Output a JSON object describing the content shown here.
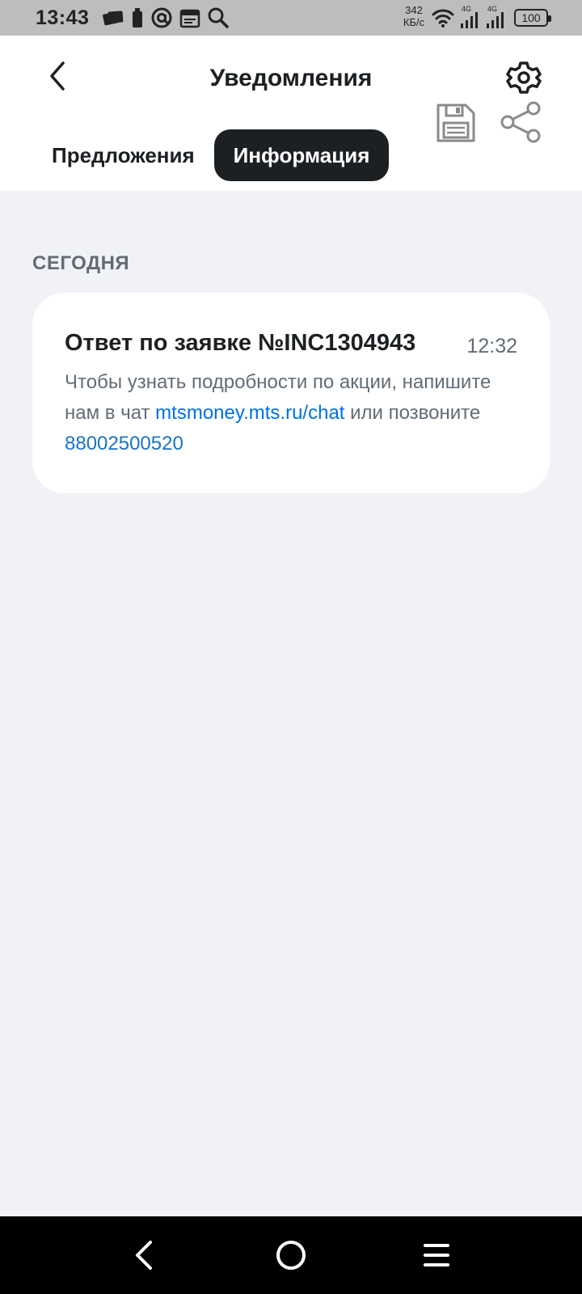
{
  "status_bar": {
    "time": "13:43",
    "speed_value": "342",
    "speed_unit": "КБ/с",
    "net1": "4G",
    "net2": "4G",
    "battery": "100"
  },
  "header": {
    "title": "Уведомления",
    "tabs": [
      {
        "label": "Предложения",
        "active": false
      },
      {
        "label": "Информация",
        "active": true
      }
    ]
  },
  "section": {
    "label": "СЕГОДНЯ"
  },
  "notification": {
    "title": "Ответ по заявке №INC1304943",
    "time": "12:32",
    "text_before": "Чтобы узнать подробности по акции, напишите нам в чат ",
    "link_chat": "mtsmoney.mts.ru/chat",
    "text_middle": " или позвоните ",
    "link_phone": "88002500520"
  },
  "colors": {
    "accent": "#1d2023",
    "link": "#0070e5",
    "background": "#f0f2f6",
    "secondary_text": "#626c77"
  }
}
